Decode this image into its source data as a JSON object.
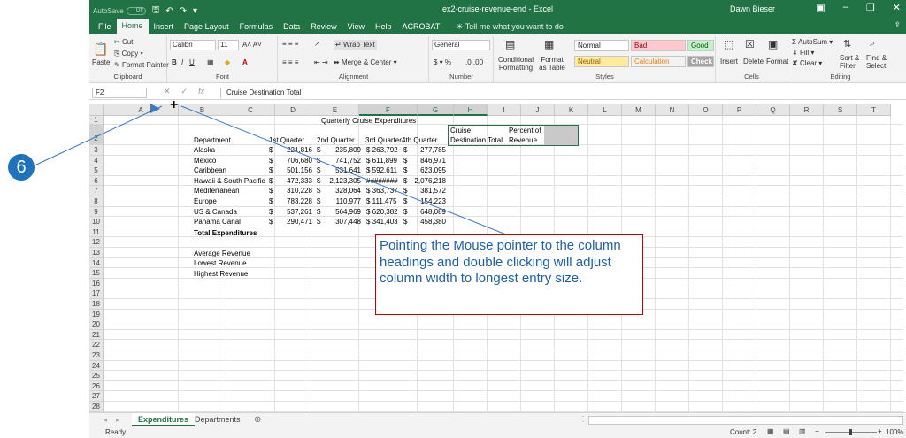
{
  "window": {
    "autosave_label": "AutoSave",
    "autosave_state": "Off",
    "title": "ex2-cruise-revenue-end - Excel",
    "user": "Dawn Bieser"
  },
  "menu": {
    "tabs": [
      "File",
      "Home",
      "Insert",
      "Page Layout",
      "Formulas",
      "Data",
      "Review",
      "View",
      "Help",
      "ACROBAT"
    ],
    "active_tab": "Home",
    "tell_me": "Tell me what you want to do"
  },
  "ribbon": {
    "clipboard": {
      "paste": "Paste",
      "cut": "Cut",
      "copy": "Copy",
      "format_painter": "Format Painter",
      "label": "Clipboard"
    },
    "font": {
      "name": "Calibri",
      "size": "11",
      "label": "Font"
    },
    "alignment": {
      "wrap_text": "Wrap Text",
      "merge_center": "Merge & Center",
      "label": "Alignment"
    },
    "number": {
      "format": "General",
      "label": "Number"
    },
    "styles": {
      "conditional": "Conditional Formatting",
      "format_as_table": "Format as Table",
      "normal": "Normal",
      "bad": "Bad",
      "good": "Good",
      "neutral": "Neutral",
      "calculation": "Calculation",
      "check_cell": "Check Cell",
      "label": "Styles"
    },
    "cells": {
      "insert": "Insert",
      "delete": "Delete",
      "format": "Format",
      "label": "Cells"
    },
    "editing": {
      "autosum": "AutoSum",
      "fill": "Fill",
      "clear": "Clear",
      "sort_filter": "Sort & Filter",
      "find_select": "Find & Select",
      "label": "Editing"
    },
    "colors": {
      "normal_bg": "#ffffff",
      "bad_bg": "#ffc7ce",
      "good_bg": "#c6efce",
      "neutral_bg": "#ffeb9c",
      "calc_bg": "#f2f2f2",
      "check_bg": "#a5a5a5"
    }
  },
  "formula_bar": {
    "name_box": "F2",
    "content": "Cruise Destination Total"
  },
  "grid": {
    "columns": [
      "A",
      "B",
      "C",
      "D",
      "E",
      "F",
      "G",
      "H",
      "I",
      "J",
      "K",
      "L",
      "M",
      "N",
      "O",
      "P",
      "Q",
      "R",
      "S",
      "T"
    ],
    "row_numbers": [
      "1",
      "2",
      "3",
      "4",
      "5",
      "6",
      "7",
      "8",
      "9",
      "10",
      "11",
      "12",
      "13",
      "14",
      "15",
      "16",
      "17",
      "18",
      "19",
      "20",
      "21",
      "22",
      "23",
      "24",
      "25",
      "26",
      "27",
      "28"
    ],
    "title": "Quarterly Cruise Expenditures",
    "headers": {
      "a": "Department",
      "b": "1st Quarter",
      "c": "2nd Quarter",
      "d": "3rd Quarter",
      "e": "4th Quarter",
      "f_line1": "Cruise",
      "f_line2": "Destination Total",
      "g_line1": "Percent of",
      "g_line2": "Revenue"
    },
    "rows": [
      {
        "dept": "Alaska",
        "q1": "221,816",
        "q2": "235,809",
        "q3": "$ 263,792",
        "q4": "277,785"
      },
      {
        "dept": "Mexico",
        "q1": "706,680",
        "q2": "741,752",
        "q3": "$ 611,899",
        "q4": "846,971"
      },
      {
        "dept": "Caribbean",
        "q1": "501,156",
        "q2": "531,641",
        "q3": "$ 592,611",
        "q4": "623,095"
      },
      {
        "dept": "Hawaii & South Pacific",
        "q1": "472,333",
        "q2": "2,123,305",
        "q3": "########",
        "q4": "2,076,218"
      },
      {
        "dept": "Mediterranean",
        "q1": "310,228",
        "q2": "328,064",
        "q3": "$ 363,737",
        "q4": "381,572"
      },
      {
        "dept": "Europe",
        "q1": "783,228",
        "q2": "110,977",
        "q3": "$ 111,475",
        "q4": "154,223"
      },
      {
        "dept": "US & Canada",
        "q1": "537,261",
        "q2": "564,969",
        "q3": "$ 620,382",
        "q4": "648,089"
      },
      {
        "dept": "Panama Canal",
        "q1": "290,471",
        "q2": "307,448",
        "q3": "$ 341,403",
        "q4": "458,380"
      }
    ],
    "currency_symbol": "$",
    "total_label": "Total Expenditures",
    "summary_labels": [
      "Average Revenue",
      "Lowest Revenue",
      "Highest Revenue"
    ]
  },
  "sheets": {
    "tabs": [
      "Expenditures",
      "Departments"
    ],
    "active": "Expenditures"
  },
  "status": {
    "ready": "Ready",
    "count": "Count: 2",
    "zoom": "100%"
  },
  "annotation": {
    "step_number": "6",
    "callout_text": "Pointing the Mouse pointer to the column headings and double clicking will adjust column width to longest entry size.",
    "pointer_symbol": "+",
    "callout_border_color": "#c00000",
    "callout_text_color": "#1a5fb4",
    "badge_color": "#1e73be"
  }
}
